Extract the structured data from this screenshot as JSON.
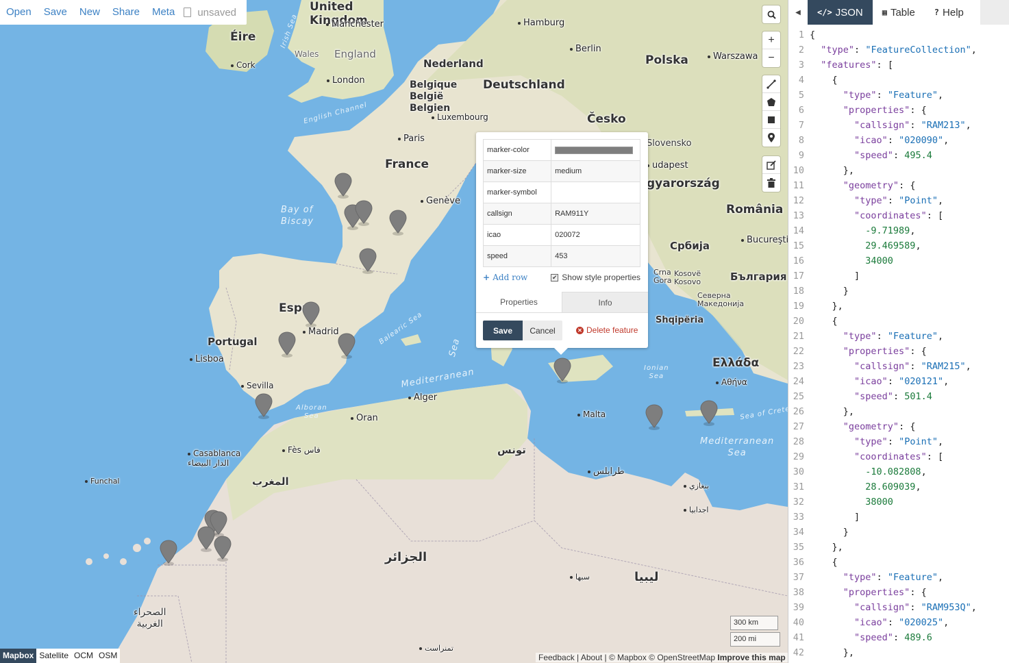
{
  "topnav": {
    "links": [
      "Open",
      "Save",
      "New",
      "Share",
      "Meta"
    ],
    "status": "unsaved"
  },
  "map": {
    "labels": {
      "countries": [
        "United Kingdom",
        "Éire",
        "England",
        "Wales",
        "Nederland",
        "Belgique België Belgien",
        "Deutschland",
        "Polska",
        "Česko",
        "France",
        "Slovensko",
        "Magyarország",
        "România",
        "Srbija",
        "България",
        "Shqipëria",
        "Ελλάδα",
        "España",
        "Portugal",
        "المغرب",
        "الجزائر",
        "ليبيا",
        "تونس",
        "الصحراء الغربية"
      ],
      "cities": [
        "Manchester",
        "Cork",
        "London",
        "Hamburg",
        "Berlin",
        "Warszawa",
        "Luxembourg",
        "Paris",
        "Genève",
        "Budapest",
        "Bucureşti",
        "Madrid",
        "Lisboa",
        "Sevilla",
        "Alger",
        "Oran",
        "Malta",
        "Fès فاس",
        "Casablanca الدار البيضاء",
        "Funchal",
        "طرابلس",
        "سبها",
        "بنغازي",
        "اجدابيا",
        "تمنراست",
        "Kosovë Kosovo",
        "Crna Gora",
        "Северна Македонија",
        "Αθήνα"
      ],
      "seas": [
        "Bay of Biscay",
        "English Channel",
        "Irish Sea",
        "Balearic Sea",
        "Mediterranean Sea",
        "Alboran Sea",
        "Ionian Sea",
        "Sea of Crete",
        "Mediterranean Sea"
      ]
    }
  },
  "controls": {
    "search_icon": "search-icon",
    "zoom_in": "+",
    "zoom_out": "−"
  },
  "popup": {
    "rows": [
      {
        "key": "marker-color",
        "value": "#7e7e7e"
      },
      {
        "key": "marker-size",
        "value": "medium"
      },
      {
        "key": "marker-symbol",
        "value": ""
      },
      {
        "key": "callsign",
        "value": "RAM911Y"
      },
      {
        "key": "icao",
        "value": "020072"
      },
      {
        "key": "speed",
        "value": "453"
      }
    ],
    "add_row": "Add row",
    "show_style": "Show style properties",
    "tabs": [
      "Properties",
      "Info"
    ],
    "save": "Save",
    "cancel": "Cancel",
    "delete": "Delete feature"
  },
  "layers": [
    "Mapbox",
    "Satellite",
    "OCM",
    "OSM"
  ],
  "scale": {
    "km": "300 km",
    "mi": "200 mi"
  },
  "attribution": {
    "text": "Feedback | About | © Mapbox © OpenStreetMap",
    "improve": "Improve this map"
  },
  "pane": {
    "tabs": [
      {
        "icon": "</>",
        "label": "JSON"
      },
      {
        "icon": "▦",
        "label": "Table"
      },
      {
        "icon": "?",
        "label": "Help"
      }
    ]
  },
  "code_lines": [
    "{",
    "  \"type\": \"FeatureCollection\",",
    "  \"features\": [",
    "    {",
    "      \"type\": \"Feature\",",
    "      \"properties\": {",
    "        \"callsign\": \"RAM213\",",
    "        \"icao\": \"020090\",",
    "        \"speed\": 495.4",
    "      },",
    "      \"geometry\": {",
    "        \"type\": \"Point\",",
    "        \"coordinates\": [",
    "          -9.71989,",
    "          29.469589,",
    "          34000",
    "        ]",
    "      }",
    "    },",
    "    {",
    "      \"type\": \"Feature\",",
    "      \"properties\": {",
    "        \"callsign\": \"RAM215\",",
    "        \"icao\": \"020121\",",
    "        \"speed\": 501.4",
    "      },",
    "      \"geometry\": {",
    "        \"type\": \"Point\",",
    "        \"coordinates\": [",
    "          -10.082808,",
    "          28.609039,",
    "          38000",
    "        ]",
    "      }",
    "    },",
    "    {",
    "      \"type\": \"Feature\",",
    "      \"properties\": {",
    "        \"callsign\": \"RAM953Q\",",
    "        \"icao\": \"020025\",",
    "        \"speed\": 489.6",
    "      },"
  ]
}
